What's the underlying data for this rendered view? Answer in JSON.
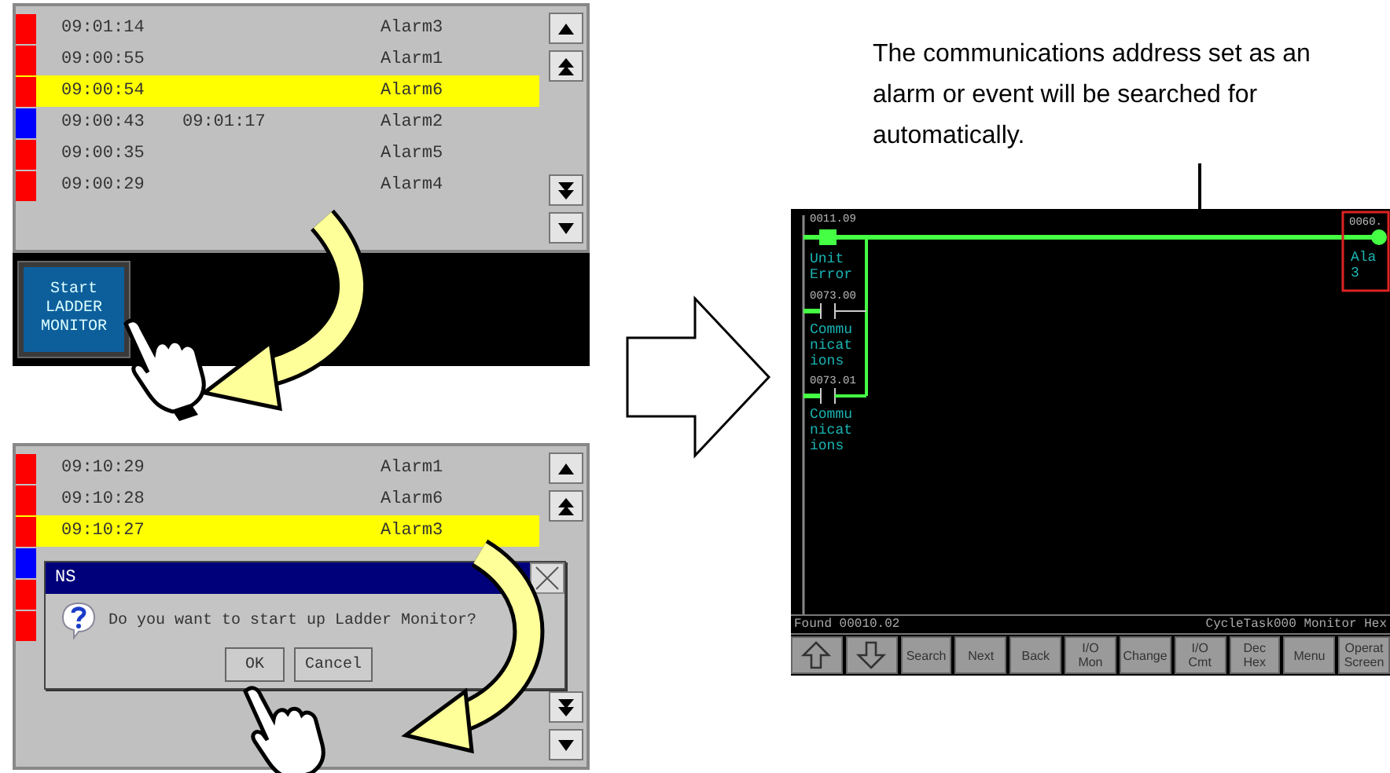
{
  "alarm_screen_before": {
    "rows": [
      {
        "color": "#ff0000",
        "time": "09:01:14",
        "alarm": "Alarm3",
        "selected": false
      },
      {
        "color": "#ff0000",
        "time": "09:00:55",
        "alarm": "Alarm1",
        "selected": false
      },
      {
        "color": "#ff0000",
        "time": "09:00:54",
        "alarm": "Alarm6",
        "selected": true
      },
      {
        "color": "#0000ff",
        "time": "09:00:43",
        "time_2": "09:01:17",
        "alarm": "Alarm2",
        "selected": false
      },
      {
        "color": "#ff0000",
        "time": "09:00:35",
        "alarm": "Alarm5",
        "selected": false
      },
      {
        "color": "#ff0000",
        "time": "09:00:29",
        "alarm": "Alarm4",
        "selected": false
      }
    ],
    "start_button": {
      "label": "Start\nLADDER\nMONITOR"
    }
  },
  "alarm_screen_dialog": {
    "rows": [
      {
        "color": "#ff0000",
        "time": "09:10:29",
        "alarm": "Alarm1",
        "selected": false
      },
      {
        "color": "#ff0000",
        "time": "09:10:28",
        "alarm": "Alarm6",
        "selected": false
      },
      {
        "color": "#ff0000",
        "time": "09:10:27",
        "alarm": "Alarm3",
        "selected": true
      },
      {
        "color": "#0000ff",
        "selected": false
      },
      {
        "color": "#ff0000",
        "selected": false
      },
      {
        "color": "#ff0000",
        "selected": false
      }
    ],
    "dialog": {
      "title": "NS",
      "message": "Do you want to start up Ladder Monitor?",
      "buttons": [
        "OK",
        "Cancel"
      ]
    }
  },
  "note": "The communications address set as an alarm or event will be searched for automatically.",
  "ladder_monitor": {
    "contacts": [
      {
        "address": "0011.09",
        "comment": "Unit Error"
      },
      {
        "address": "0073.00",
        "comment": "Communications"
      },
      {
        "address": "0073.01",
        "comment": "Communications"
      }
    ],
    "coil": {
      "address": "0060.",
      "comment": "Ala 3"
    },
    "status_left": "Found 00010.02",
    "status_right": "CycleTask000 Monitor Hex",
    "toolbar": [
      {
        "kind": "up"
      },
      {
        "kind": "down"
      },
      {
        "kind": "text",
        "label": "Search"
      },
      {
        "kind": "text",
        "label": "Next"
      },
      {
        "kind": "text",
        "label": "Back"
      },
      {
        "kind": "text",
        "label": "I/O\nMon"
      },
      {
        "kind": "text",
        "label": "Change"
      },
      {
        "kind": "text",
        "label": "I/O\nCmt"
      },
      {
        "kind": "text",
        "label": "Dec\nHex"
      },
      {
        "kind": "text",
        "label": "Menu"
      },
      {
        "kind": "text",
        "label": "Operat\nScreen"
      }
    ]
  }
}
